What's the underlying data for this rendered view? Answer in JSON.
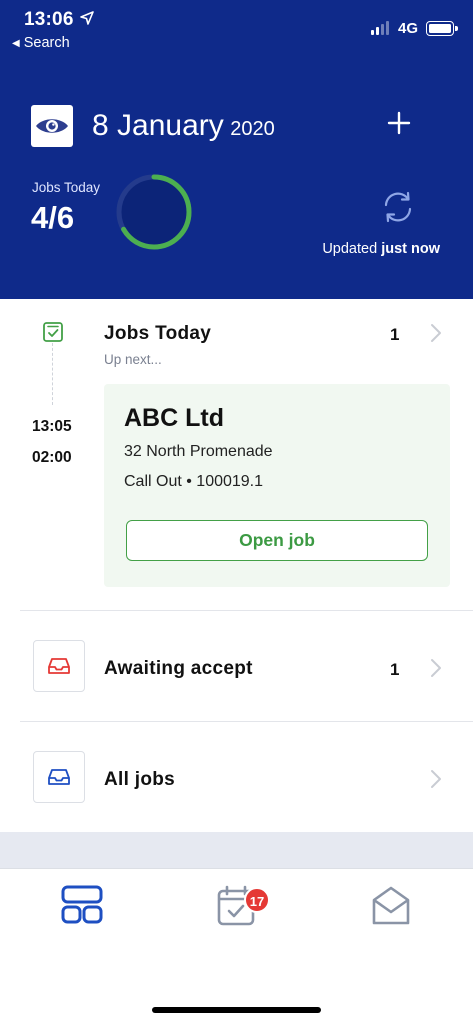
{
  "status_bar": {
    "time": "13:06",
    "back_label": "Search",
    "network": "4G"
  },
  "header": {
    "date_main": "8 January",
    "date_year": "2020",
    "jobs_today_label": "Jobs Today",
    "jobs_count": "4/6",
    "jobs_done": 4,
    "jobs_total": 6,
    "updated_prefix": "Updated",
    "updated_value": "just now",
    "bg_color": "#0f2a8a"
  },
  "jobs_today": {
    "title": "Jobs Today",
    "count": "1",
    "subtitle": "Up next...",
    "start_time": "13:05",
    "duration": "02:00",
    "job": {
      "name": "ABC Ltd",
      "address": "32 North Promenade",
      "meta": "Call Out • 100019.1",
      "open_label": "Open job"
    }
  },
  "awaiting": {
    "title": "Awaiting accept",
    "count": "1"
  },
  "all_jobs": {
    "title": "All jobs"
  },
  "tabbar": {
    "badge": "17",
    "icons": [
      "dashboard-icon",
      "calendar-check-icon",
      "inbox-mail-icon"
    ]
  },
  "colors": {
    "accent_green": "#43a047",
    "accent_blue": "#1e4fc2",
    "accent_red": "#e53935"
  }
}
